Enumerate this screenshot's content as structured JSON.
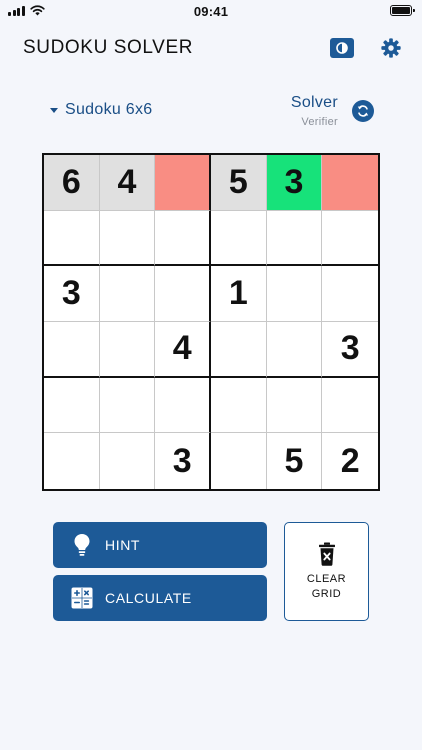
{
  "status_bar": {
    "time": "09:41"
  },
  "header": {
    "title": "SUDOKU SOLVER",
    "theme_icon": "theme-toggle-icon",
    "settings_icon": "gear-icon"
  },
  "controls": {
    "variant_label": "Sudoku 6x6",
    "mode_selected": "Solver",
    "mode_alternate": "Verifier"
  },
  "colors": {
    "accent": "#1d5a97",
    "cell_given": "#e0e0e0",
    "cell_conflict": "#f98d83",
    "cell_correct": "#17e27a"
  },
  "grid": {
    "size": 6,
    "rows": [
      [
        {
          "value": "6",
          "state": "given"
        },
        {
          "value": "4",
          "state": "given"
        },
        {
          "value": "",
          "state": "conflict"
        },
        {
          "value": "5",
          "state": "given"
        },
        {
          "value": "3",
          "state": "correct"
        },
        {
          "value": "",
          "state": "conflict"
        }
      ],
      [
        {
          "value": "",
          "state": "empty"
        },
        {
          "value": "",
          "state": "empty"
        },
        {
          "value": "",
          "state": "empty"
        },
        {
          "value": "",
          "state": "empty"
        },
        {
          "value": "",
          "state": "empty"
        },
        {
          "value": "",
          "state": "empty"
        }
      ],
      [
        {
          "value": "3",
          "state": "empty"
        },
        {
          "value": "",
          "state": "empty"
        },
        {
          "value": "",
          "state": "empty"
        },
        {
          "value": "1",
          "state": "empty"
        },
        {
          "value": "",
          "state": "empty"
        },
        {
          "value": "",
          "state": "empty"
        }
      ],
      [
        {
          "value": "",
          "state": "empty"
        },
        {
          "value": "",
          "state": "empty"
        },
        {
          "value": "4",
          "state": "empty"
        },
        {
          "value": "",
          "state": "empty"
        },
        {
          "value": "",
          "state": "empty"
        },
        {
          "value": "3",
          "state": "empty"
        }
      ],
      [
        {
          "value": "",
          "state": "empty"
        },
        {
          "value": "",
          "state": "empty"
        },
        {
          "value": "",
          "state": "empty"
        },
        {
          "value": "",
          "state": "empty"
        },
        {
          "value": "",
          "state": "empty"
        },
        {
          "value": "",
          "state": "empty"
        }
      ],
      [
        {
          "value": "",
          "state": "empty"
        },
        {
          "value": "",
          "state": "empty"
        },
        {
          "value": "3",
          "state": "empty"
        },
        {
          "value": "",
          "state": "empty"
        },
        {
          "value": "5",
          "state": "empty"
        },
        {
          "value": "2",
          "state": "empty"
        }
      ]
    ]
  },
  "buttons": {
    "hint_label": "HINT",
    "hint_icon": "lightbulb-icon",
    "calculate_label": "CALCULATE",
    "calculate_icon": "calculator-icon",
    "clear_label_line1": "CLEAR",
    "clear_label_line2": "GRID",
    "clear_icon": "trash-icon"
  }
}
